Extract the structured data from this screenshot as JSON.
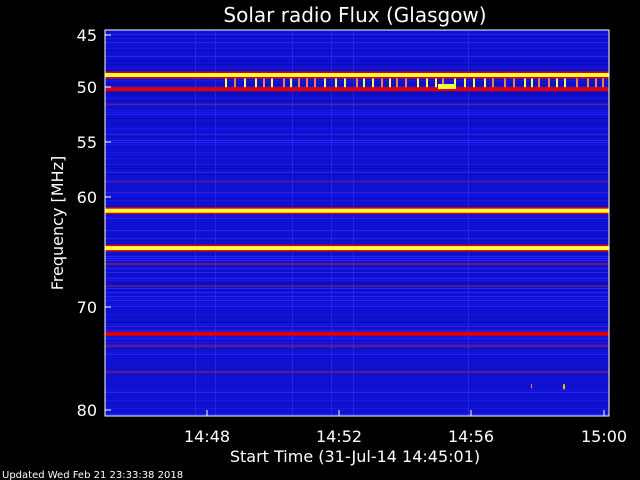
{
  "chart_data": {
    "type": "heatmap",
    "title": "Solar radio Flux (Glasgow)",
    "xlabel": "Start Time (31-Jul-14 14:45:01)",
    "ylabel": "Frequency [MHz]",
    "x_range": [
      "14:45:01",
      "15:00"
    ],
    "y_range": [
      45,
      80
    ],
    "x_ticks": [
      "14:48",
      "14:52",
      "14:56",
      "15:00"
    ],
    "y_ticks": [
      45,
      50,
      55,
      60,
      70,
      80
    ],
    "y_scale": "nonlinear",
    "colors": {
      "background": "#1010d0",
      "band_low": "#3030ff",
      "band_mid": "#e00000",
      "band_high": "#ffff40"
    },
    "bright_bands_mhz": [
      {
        "freq": 48.8,
        "level": "high"
      },
      {
        "freq": 50.2,
        "level": "mid"
      },
      {
        "freq": 61.2,
        "level": "high"
      },
      {
        "freq": 64.6,
        "level": "high"
      },
      {
        "freq": 72.6,
        "level": "mid"
      }
    ],
    "grid": false
  },
  "footer": {
    "updated": "Updated Wed Feb 21 23:33:38 2018"
  }
}
